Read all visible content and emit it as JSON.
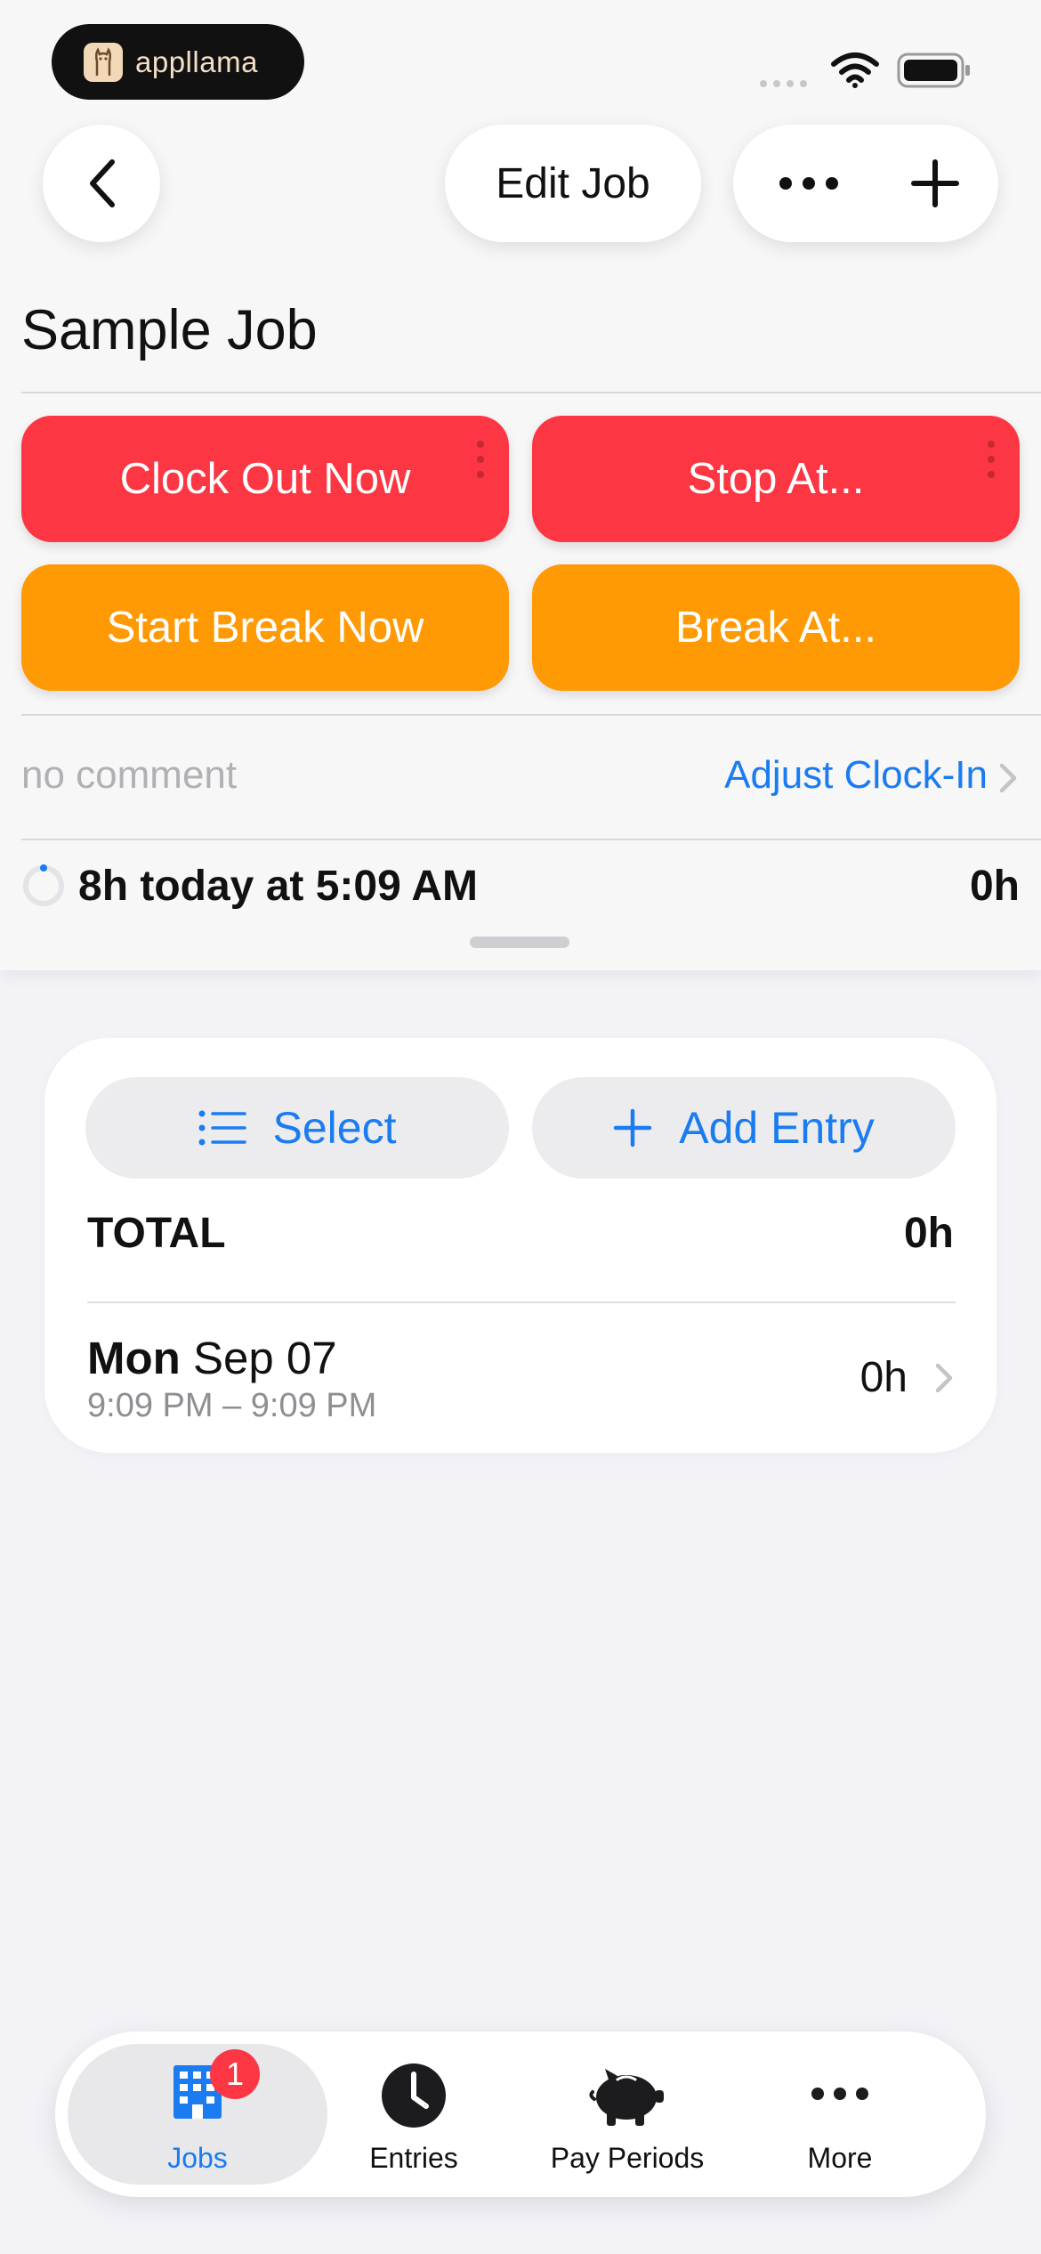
{
  "status_bar": {
    "brand": "appllama"
  },
  "nav": {
    "back_label": "Back",
    "edit_job_label": "Edit Job",
    "more_label": "More options",
    "add_label": "Add"
  },
  "page": {
    "title": "Sample Job"
  },
  "actions": {
    "clock_out_now": "Clock Out Now",
    "stop_at": "Stop At...",
    "start_break_now": "Start Break Now",
    "break_at": "Break At...",
    "colors": {
      "red": "#fc3642",
      "orange": "#ff9a05"
    }
  },
  "comment": {
    "placeholder": "no comment",
    "adjust_clock_in": "Adjust Clock-In"
  },
  "summary": {
    "text": "8h today at 5:09 AM",
    "total": "0h"
  },
  "card": {
    "select_label": "Select",
    "add_entry_label": "Add Entry",
    "total_label": "TOTAL",
    "total_value": "0h",
    "entries": [
      {
        "weekday": "Mon",
        "date": "Sep 07",
        "time_range": "9:09 PM – 9:09 PM",
        "duration": "0h"
      }
    ]
  },
  "tab_bar": {
    "tabs": [
      {
        "label": "Jobs",
        "icon": "building-icon",
        "selected": true,
        "badge": "1"
      },
      {
        "label": "Entries",
        "icon": "clock-icon",
        "selected": false
      },
      {
        "label": "Pay Periods",
        "icon": "piggy-bank-icon",
        "selected": false
      },
      {
        "label": "More",
        "icon": "ellipsis-icon",
        "selected": false
      }
    ]
  },
  "accent_color": "#1a7cf0"
}
